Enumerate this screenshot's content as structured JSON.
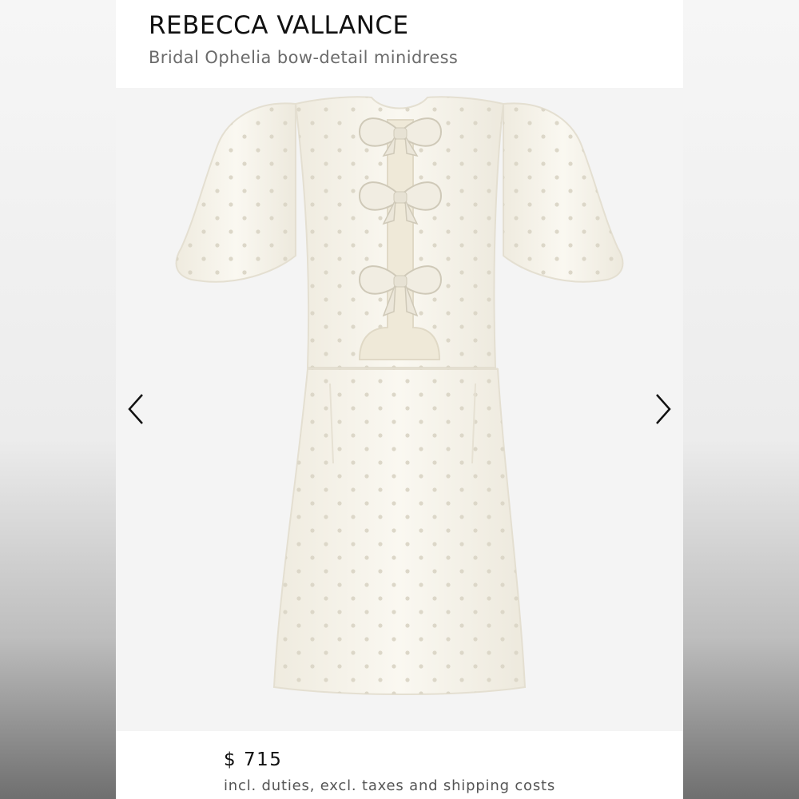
{
  "product": {
    "brand": "REBECCA VALLANCE",
    "name": "Bridal Ophelia bow-detail minidress",
    "price": "$ 715",
    "price_note": "incl. duties, excl. taxes and shipping costs"
  },
  "gallery": {
    "image_subject": "white-minidress-with-bows",
    "prev_icon": "chevron-left-icon",
    "next_icon": "chevron-right-icon"
  },
  "colors": {
    "dress": "#f7f4ea",
    "pearl": "#d9d4c6",
    "text_primary": "#111111",
    "text_secondary": "#6b6b6b"
  }
}
